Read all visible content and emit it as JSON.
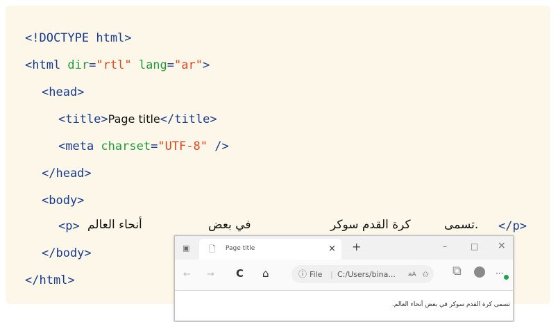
{
  "code": {
    "line1": "<!DOCTYPE html>",
    "line2": {
      "open": "<html ",
      "a1": "dir",
      "eq": "=",
      "v1": "\"rtl\"",
      "sp": " ",
      "a2": "lang",
      "eq2": "=",
      "v2": "\"ar\"",
      "close": ">"
    },
    "line3": "<head>",
    "line4": {
      "open": "<title>",
      "text": "Page title",
      "close": "</title>"
    },
    "line5": {
      "open": "<meta ",
      "a1": "charset",
      "eq": "=",
      "v1": "\"UTF-8\"",
      "close": " />"
    },
    "line6": "</head>",
    "line7": "<body>",
    "line8": {
      "open": "<p>",
      "close": "</p>",
      "word_ar1": "أنحاء العالم",
      "word_ar2": "في بعض",
      "word_ar3": "كرة القدم سوكر",
      "word_ar4": ".تسمى"
    },
    "line9": "</body>",
    "line10": "</html>"
  },
  "browser": {
    "tab_title": "Page title",
    "tab_close": "×",
    "new_tab": "+",
    "minimize": "–",
    "maximize": "□",
    "close": "×",
    "back": "←",
    "forward": "→",
    "refresh": "C",
    "home": "⌂",
    "info": "ⓘ",
    "file_label": "File",
    "url": "C:/Users/bina...",
    "read_aloud": "aA",
    "favorites": "✩",
    "more": "···",
    "page_text": "تسمى كرة القدم سوكر في بعض أنحاء العالم."
  }
}
